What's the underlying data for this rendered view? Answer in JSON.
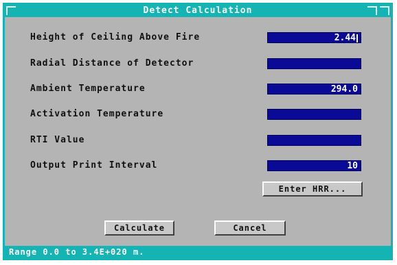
{
  "window": {
    "title": "Detect Calculation"
  },
  "fields": [
    {
      "label": "Height of Ceiling Above Fire",
      "value": "2.44"
    },
    {
      "label": "Radial Distance of Detector",
      "value": ""
    },
    {
      "label": "Ambient Temperature",
      "value": "294.0"
    },
    {
      "label": "Activation Temperature",
      "value": ""
    },
    {
      "label": "RTI Value",
      "value": ""
    },
    {
      "label": "Output Print Interval",
      "value": "10"
    }
  ],
  "buttons": {
    "enter_hrr": "Enter HRR...",
    "calculate": "Calculate",
    "cancel": "Cancel"
  },
  "status": {
    "text": "Range 0.0 to 3.4E+020 m."
  },
  "colors": {
    "titlebar": "#14b4b4",
    "background": "#b4b4b4",
    "input": "#0a0a96"
  }
}
